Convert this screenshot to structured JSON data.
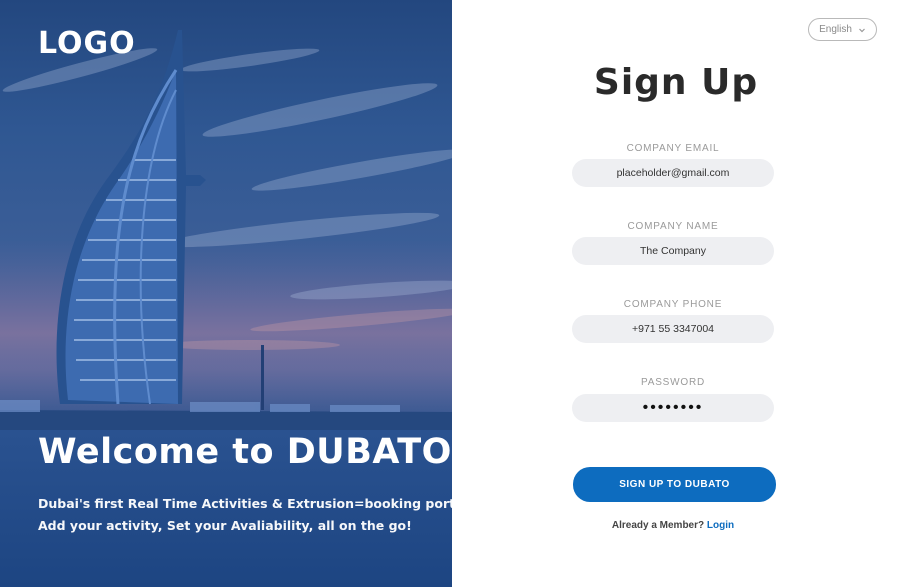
{
  "brand": {
    "logo_text": "LOGO"
  },
  "hero": {
    "title": "Welcome to DUBATO",
    "line1": "Dubai's first Real Time Activities & Extrusion=booking portal.",
    "line2": "Add your activity, Set your Avaliability, all on the go!"
  },
  "language": {
    "selected": "English",
    "icon": "chevron-down-icon"
  },
  "form": {
    "title": "Sign Up",
    "fields": [
      {
        "label": "COMPANY EMAIL",
        "value": "placeholder@gmail.com"
      },
      {
        "label": "COMPANY NAME",
        "value": "The Company"
      },
      {
        "label": "COMPANY PHONE",
        "value": "+971 55 3347004"
      },
      {
        "label": "PASSWORD",
        "value": "••••••••"
      }
    ],
    "submit_label": "SIGN UP TO DUBATO",
    "member_text": "Already a Member?",
    "login_label": "Login"
  },
  "colors": {
    "accent": "#0d6cbf",
    "hero_blue": "#2f5792",
    "field_bg": "#eeeff2"
  }
}
